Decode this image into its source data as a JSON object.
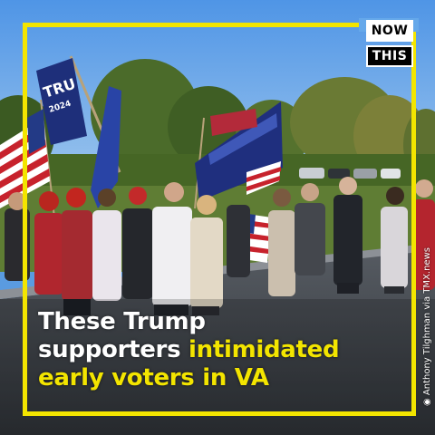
{
  "logo": {
    "line1": "NOW",
    "line2": "THIS"
  },
  "caption": {
    "l1a": "These Trump",
    "l2a": "supporters ",
    "l2b": "intimidated",
    "l3a": "early voters in VA"
  },
  "credit": "Anthony Tilghman via TMX.news",
  "flags": {
    "trump_flag_text": "TRU",
    "flag_sub": "2024"
  },
  "colors": {
    "frame": "#f3e500",
    "sky": "#5a9be0",
    "accent_yellow": "#f3e500"
  }
}
